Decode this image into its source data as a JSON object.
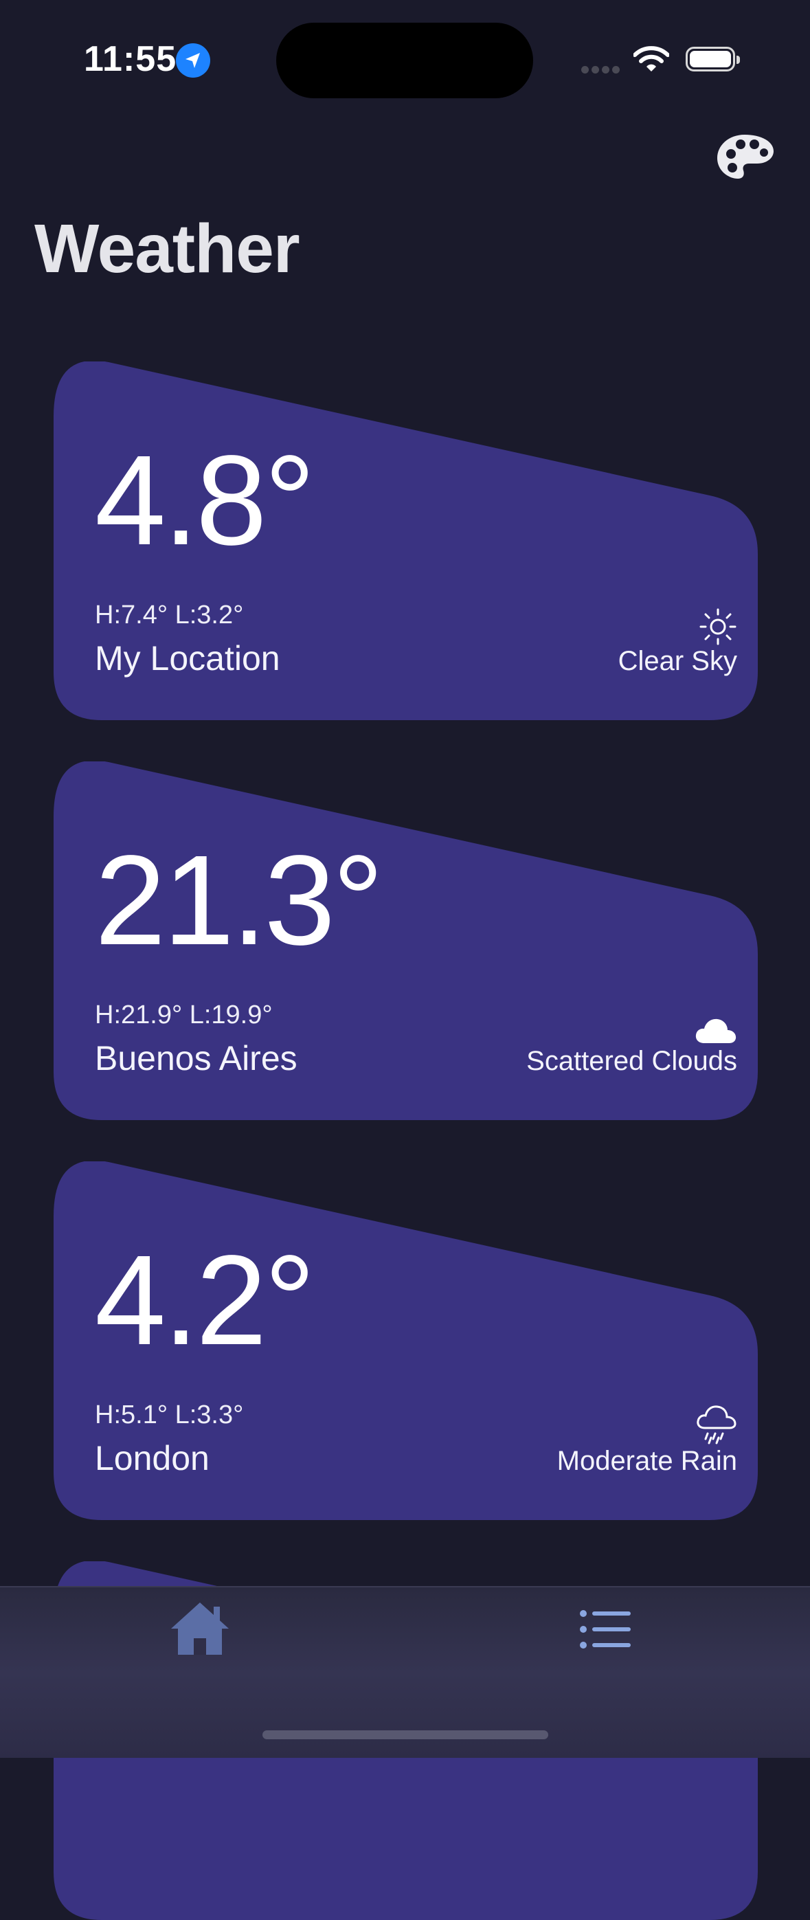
{
  "status_bar": {
    "time": "11:55"
  },
  "header": {
    "title": "Weather"
  },
  "cities": [
    {
      "temp": "4.8°",
      "hilo": "H:7.4° L:3.2°",
      "name": "My Location",
      "condition": "Clear Sky",
      "icon": "sun-icon"
    },
    {
      "temp": "21.3°",
      "hilo": "H:21.9° L:19.9°",
      "name": "Buenos Aires",
      "condition": "Scattered Clouds",
      "icon": "cloud-icon"
    },
    {
      "temp": "4.2°",
      "hilo": "H:5.1° L:3.3°",
      "name": "London",
      "condition": "Moderate Rain",
      "icon": "rain-cloud-icon"
    }
  ],
  "tab_bar": {
    "items": [
      {
        "icon": "home-icon"
      },
      {
        "icon": "list-icon"
      }
    ]
  },
  "colors": {
    "background": "#1a1a2b",
    "card": "#3a3382",
    "location_accent": "#1d83ff",
    "tab_icon_home": "#5b6ea6",
    "tab_icon_list": "#8aa6e0"
  }
}
